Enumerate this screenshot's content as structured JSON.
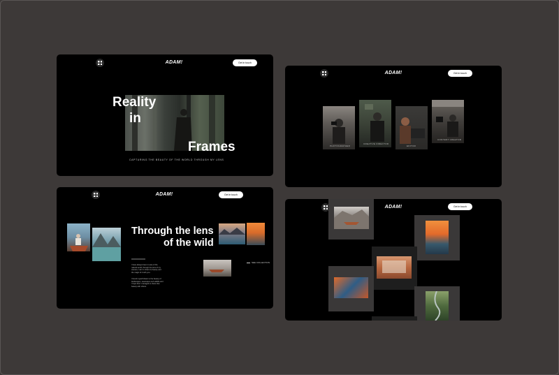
{
  "brand": "ADAM!",
  "cta_label": "Get in touch",
  "hero": {
    "line1": "Reality",
    "line2": "in",
    "line3": "Frames",
    "tagline": "CAPTURING THE BEAUTY OF THE WORLD THROUGH MY LENS"
  },
  "roles": [
    {
      "label": "PHOTOGRAPHER"
    },
    {
      "label": "CREATIVE DIRECTOR"
    },
    {
      "label": "EDITOR"
    },
    {
      "label": "CONTENT CREATOR"
    }
  ],
  "wild": {
    "line1": "Through the lens",
    "line2": "of the wild",
    "small_label": "",
    "para1": "I have always been in awe of the natural world, through the lens of my camera, I aim to share its beauty and the magic of it with you.",
    "para2": "I found myself drawn to the beauty of landscapes, seascapes and wildlife and I hope that I managed to share that beauty with others.",
    "link": "SEE COLLECTION"
  },
  "colors": {
    "background": "#3d3938",
    "panel": "#000000",
    "card": "#3a3838",
    "text": "#ffffff"
  }
}
